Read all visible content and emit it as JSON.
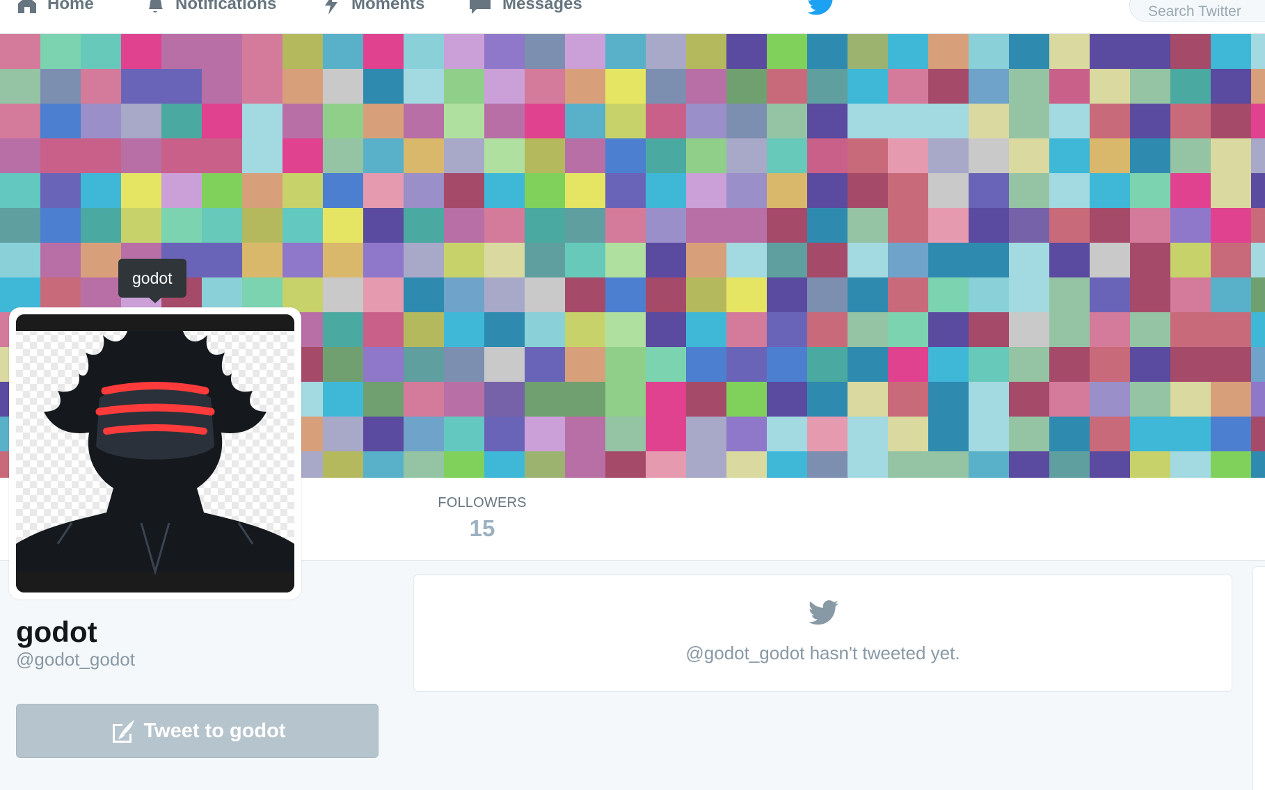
{
  "nav": {
    "home_label": "Home",
    "notifications_label": "Notifications",
    "moments_label": "Moments",
    "messages_label": "Messages",
    "search_placeholder": "Search Twitter"
  },
  "tooltip": {
    "text": "godot"
  },
  "profile": {
    "name": "godot",
    "handle": "@godot_godot",
    "tweet_to_label": "Tweet to godot"
  },
  "stats": {
    "followers_label": "FOLLOWERS",
    "followers_value": "15"
  },
  "timeline": {
    "empty_message": "@godot_godot hasn't tweeted yet."
  },
  "colors": {
    "accent": "#1da1f2",
    "muted_text": "#66757f",
    "button_disabled": "#b6c4cd"
  },
  "icons": {
    "home": "home-icon",
    "notifications": "bell-icon",
    "moments": "lightning-icon",
    "messages": "envelope-icon",
    "logo": "bird-logo-icon",
    "compose": "quill-icon"
  }
}
